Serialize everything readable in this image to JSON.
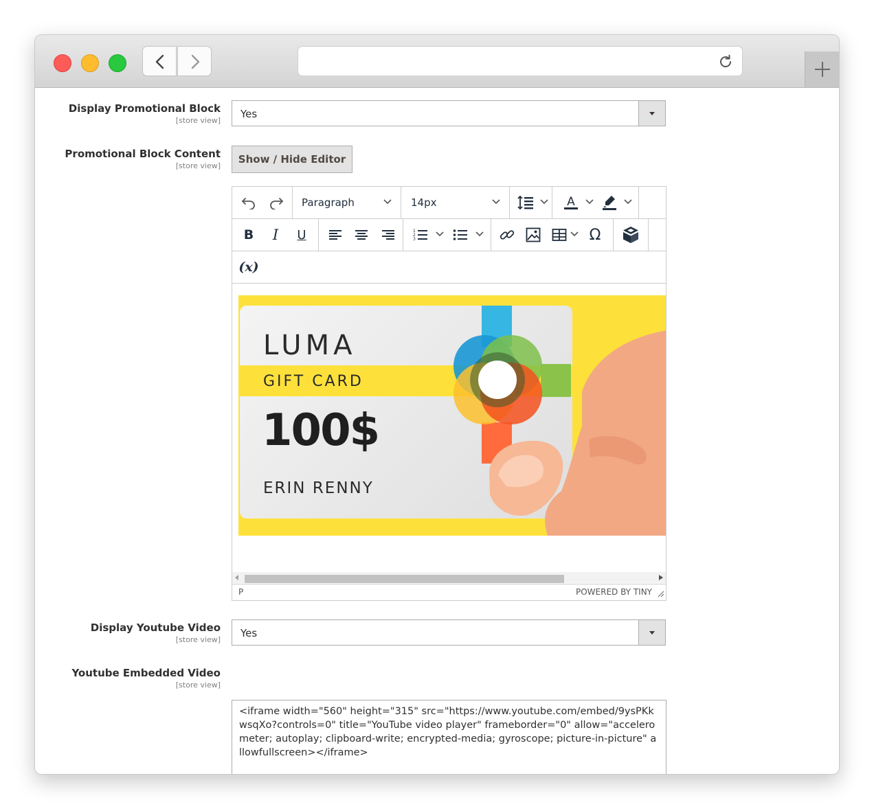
{
  "browser": {
    "url": "",
    "icons": {
      "back": "chevron-left-icon",
      "forward": "chevron-right-icon",
      "reload": "reload-icon",
      "new_tab": "plus-icon"
    }
  },
  "fields": {
    "display_promo": {
      "label": "Display Promotional Block",
      "scope": "[store view]",
      "value": "Yes"
    },
    "promo_content": {
      "label": "Promotional Block Content",
      "scope": "[store view]",
      "toggle_button": "Show / Hide Editor"
    },
    "display_youtube": {
      "label": "Display Youtube Video",
      "scope": "[store view]",
      "value": "Yes"
    },
    "youtube_embed": {
      "label": "Youtube Embedded Video",
      "scope": "[store view]",
      "value": "<iframe width=\"560\" height=\"315\" src=\"https://www.youtube.com/embed/9ysPKkwsqXo?controls=0\" title=\"YouTube video player\" frameborder=\"0\" allow=\"accelerometer; autoplay; clipboard-write; encrypted-media; gyroscope; picture-in-picture\" allowfullscreen></iframe>"
    }
  },
  "editor": {
    "block_format": "Paragraph",
    "font_size": "14px",
    "variable_button": "(x)",
    "status_path": "P",
    "powered_by": "POWERED BY TINY",
    "gift_card": {
      "brand": "LUMA",
      "title": "GIFT CARD",
      "amount": "100$",
      "holder": "ERIN RENNY"
    },
    "colors": {
      "banner": "#fde13a",
      "skin": "#f2a983"
    }
  }
}
